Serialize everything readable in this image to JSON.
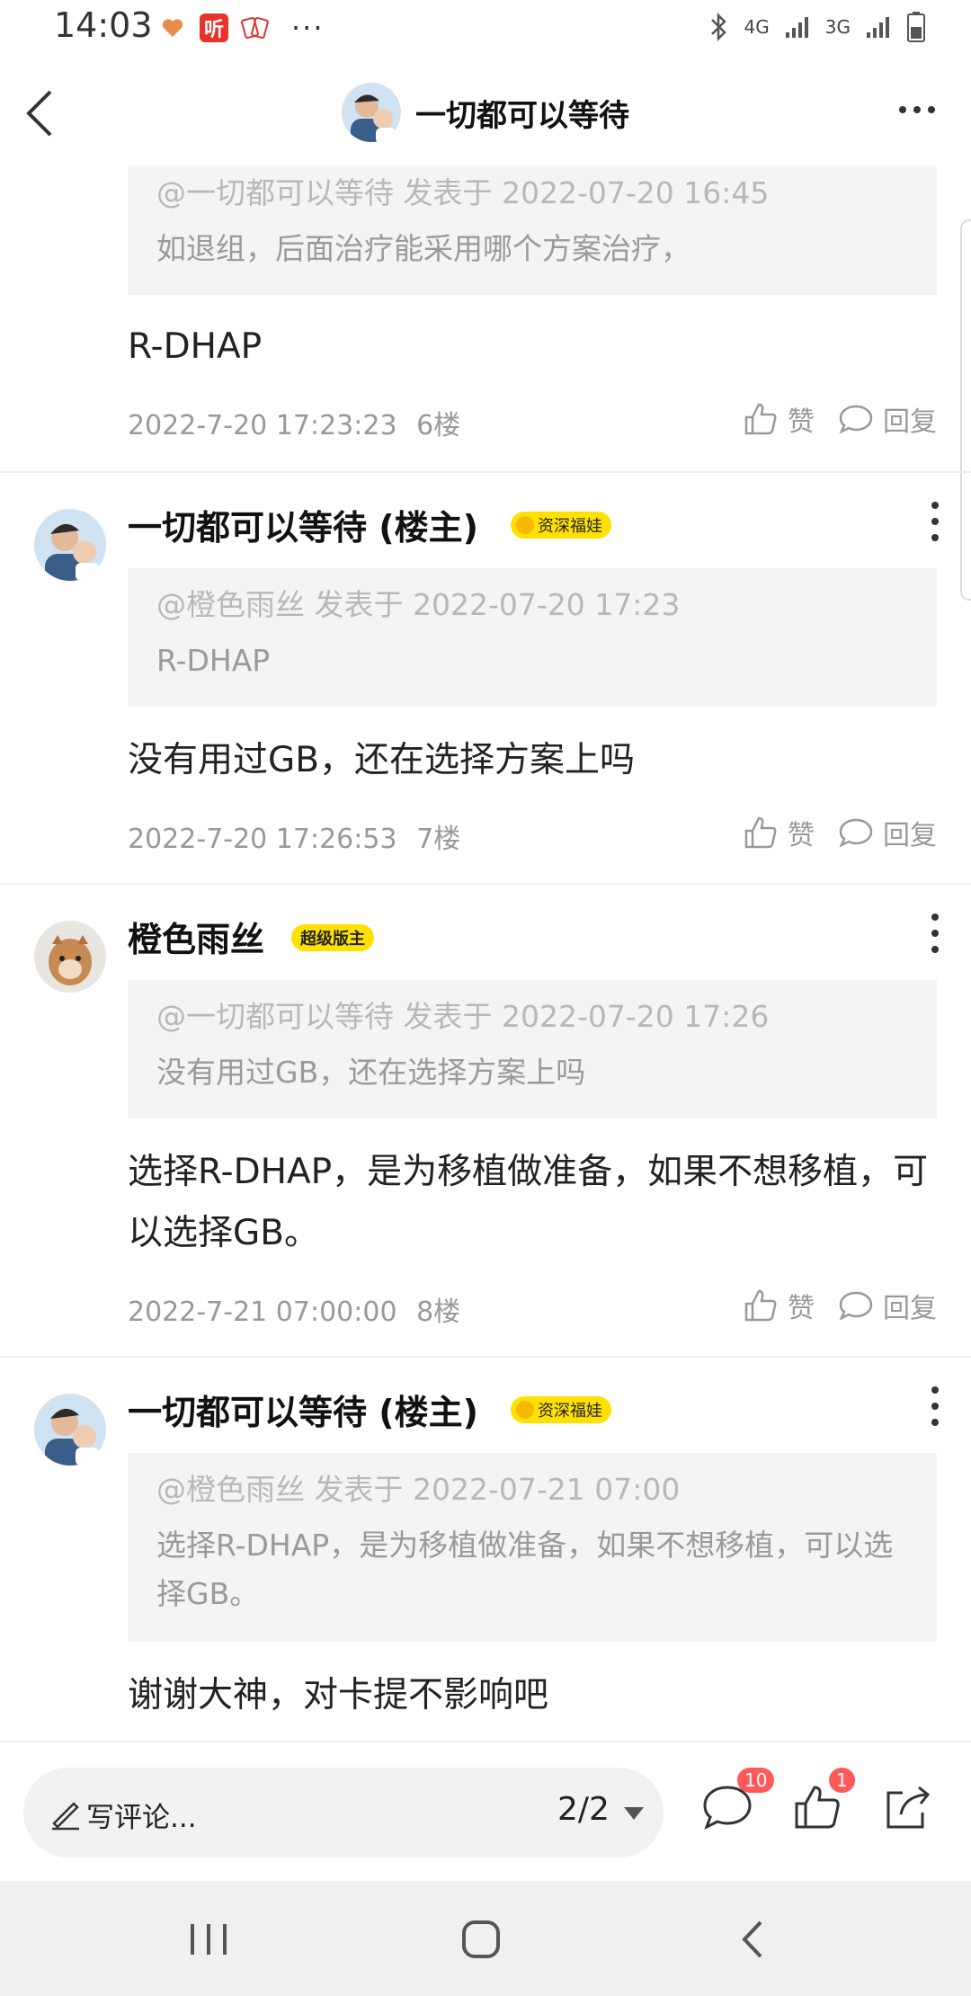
{
  "status_bar": {
    "time": "14:03",
    "net_4g": "4G",
    "net_3g": "3G",
    "listen_app_label": "听"
  },
  "header": {
    "title": "一切都可以等待"
  },
  "posts": [
    {
      "quote_meta": "@一切都可以等待 发表于 2022-07-20 16:45",
      "quote_text": "如退组，后面治疗能采用哪个方案治疗，",
      "content": "R-DHAP",
      "time": "2022-7-20 17:23:23",
      "floor": "6楼",
      "like_label": "赞",
      "reply_label": "回复"
    },
    {
      "author": "一切都可以等待 (楼主)",
      "badge": "资深福娃",
      "quote_meta": "@橙色雨丝 发表于 2022-07-20 17:23",
      "quote_text": "R-DHAP",
      "content": "没有用过GB，还在选择方案上吗",
      "time": "2022-7-20 17:26:53",
      "floor": "7楼",
      "like_label": "赞",
      "reply_label": "回复"
    },
    {
      "author": "橙色雨丝",
      "badge": "超级版主",
      "quote_meta": "@一切都可以等待 发表于 2022-07-20 17:26",
      "quote_text": "没有用过GB，还在选择方案上吗",
      "content": "选择R-DHAP，是为移植做准备，如果不想移植，可以选择GB。",
      "time": "2022-7-21 07:00:00",
      "floor": "8楼",
      "like_label": "赞",
      "reply_label": "回复"
    },
    {
      "author": "一切都可以等待 (楼主)",
      "badge": "资深福娃",
      "quote_meta": "@橙色雨丝 发表于 2022-07-21 07:00",
      "quote_text": "选择R-DHAP，是为移植做准备，如果不想移植，可以选择GB。",
      "content": "谢谢大神，对卡提不影响吧"
    }
  ],
  "bottom_bar": {
    "comment_placeholder": "写评论...",
    "page_indicator": "2/2",
    "comment_count": "10",
    "like_count": "1"
  },
  "colors": {
    "badge_yellow": "#ffe100",
    "notification_red": "#ff5a5a",
    "quote_bg": "#f4f4f4"
  }
}
